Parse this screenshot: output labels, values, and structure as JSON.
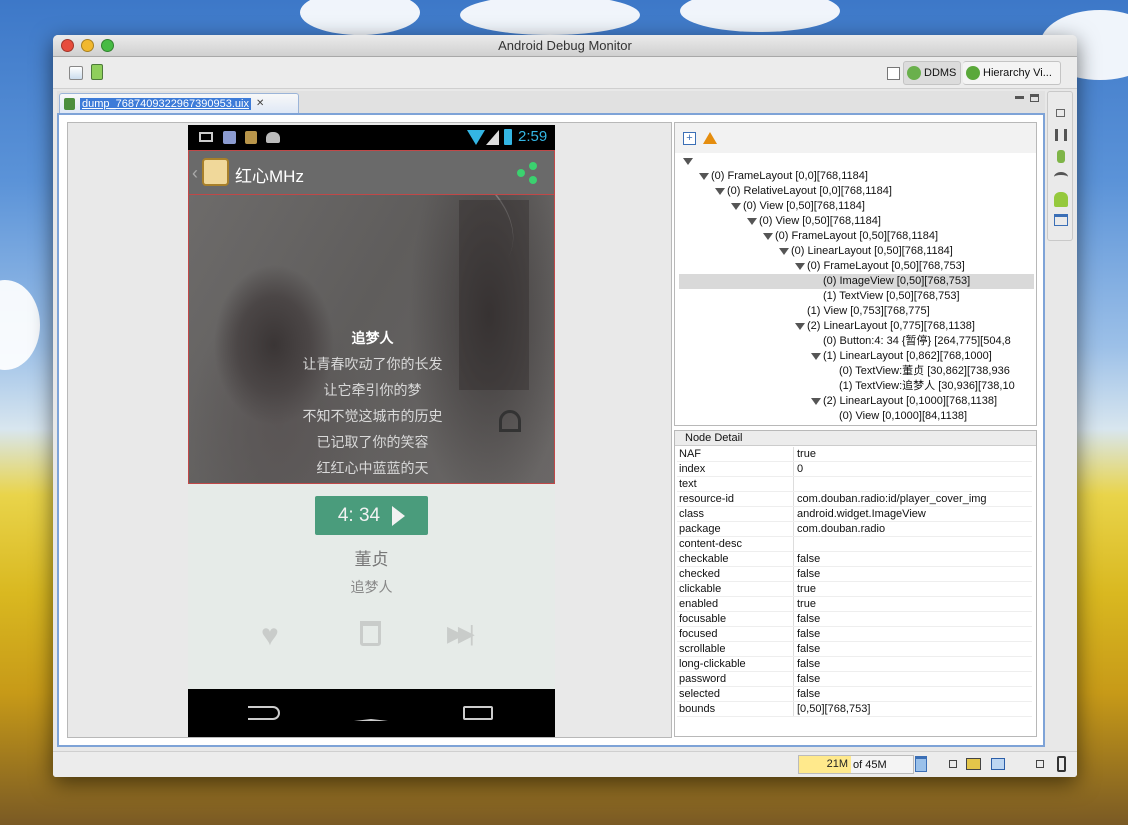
{
  "window": {
    "title": "Android Debug Monitor"
  },
  "toolbar": {
    "perspectives": [
      {
        "label": "DDMS",
        "active": true
      },
      {
        "label": "Hierarchy Vi...",
        "active": false
      }
    ]
  },
  "editor_tab": {
    "label": "dump_7687409322967390953.uix",
    "close": "✕"
  },
  "device": {
    "status_time": "2:59",
    "app_title": "红心MHz",
    "lyrics_title": "追梦人",
    "lyrics": [
      "让青春吹动了你的长发",
      "让它牵引你的梦",
      "不知不觉这城市的历史",
      "已记取了你的笑容",
      "红红心中蓝蓝的天"
    ],
    "play_label": "4: 34",
    "artist": "董贞",
    "song": "追梦人"
  },
  "tree": {
    "nodes": [
      {
        "level": 0,
        "expander": "",
        "text": ""
      },
      {
        "level": 1,
        "expander": "open",
        "text": "(0) FrameLayout [0,0][768,1184]"
      },
      {
        "level": 2,
        "expander": "open",
        "text": "(0) RelativeLayout [0,0][768,1184]"
      },
      {
        "level": 3,
        "expander": "open",
        "text": "(0) View [0,50][768,1184]"
      },
      {
        "level": 4,
        "expander": "open",
        "text": "(0) View [0,50][768,1184]"
      },
      {
        "level": 5,
        "expander": "open",
        "text": "(0) FrameLayout [0,50][768,1184]"
      },
      {
        "level": 6,
        "expander": "open",
        "text": "(0) LinearLayout [0,50][768,1184]"
      },
      {
        "level": 7,
        "expander": "open",
        "text": "(0) FrameLayout [0,50][768,753]"
      },
      {
        "level": 8,
        "expander": "none",
        "text": "(0) ImageView [0,50][768,753]",
        "selected": true
      },
      {
        "level": 8,
        "expander": "none",
        "text": "(1) TextView [0,50][768,753]"
      },
      {
        "level": 7,
        "expander": "none",
        "text": "(1) View [0,753][768,775]"
      },
      {
        "level": 7,
        "expander": "open",
        "text": "(2) LinearLayout [0,775][768,1138]"
      },
      {
        "level": 8,
        "expander": "none",
        "text": "(0) Button:4: 34 {暂停} [264,775][504,8"
      },
      {
        "level": 8,
        "expander": "open",
        "text": "(1) LinearLayout [0,862][768,1000]"
      },
      {
        "level": 9,
        "expander": "none",
        "text": "(0) TextView:董贞 [30,862][738,936"
      },
      {
        "level": 9,
        "expander": "none",
        "text": "(1) TextView:追梦人 [30,936][738,10"
      },
      {
        "level": 8,
        "expander": "open",
        "text": "(2) LinearLayout [0,1000][768,1138]"
      },
      {
        "level": 9,
        "expander": "none",
        "text": "(0) View [0,1000][84,1138]"
      }
    ]
  },
  "node_detail": {
    "header": "Node Detail",
    "rows": [
      {
        "key": "NAF",
        "value": "true"
      },
      {
        "key": "index",
        "value": "0"
      },
      {
        "key": "text",
        "value": ""
      },
      {
        "key": "resource-id",
        "value": "com.douban.radio:id/player_cover_img"
      },
      {
        "key": "class",
        "value": "android.widget.ImageView"
      },
      {
        "key": "package",
        "value": "com.douban.radio"
      },
      {
        "key": "content-desc",
        "value": ""
      },
      {
        "key": "checkable",
        "value": "false"
      },
      {
        "key": "checked",
        "value": "false"
      },
      {
        "key": "clickable",
        "value": "true"
      },
      {
        "key": "enabled",
        "value": "true"
      },
      {
        "key": "focusable",
        "value": "false"
      },
      {
        "key": "focused",
        "value": "false"
      },
      {
        "key": "scrollable",
        "value": "false"
      },
      {
        "key": "long-clickable",
        "value": "false"
      },
      {
        "key": "password",
        "value": "false"
      },
      {
        "key": "selected",
        "value": "false"
      },
      {
        "key": "bounds",
        "value": "[0,50][768,753]"
      }
    ]
  },
  "status": {
    "heap_used": "21M",
    "heap_total": "of 45M"
  },
  "icons": {
    "close": "close-icon",
    "minimize": "minimize-icon",
    "zoom": "zoom-icon"
  }
}
